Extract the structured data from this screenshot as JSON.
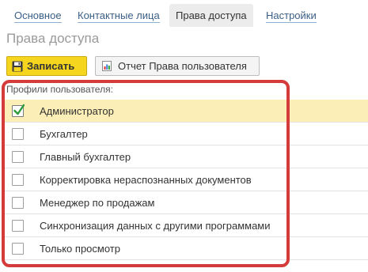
{
  "tabs": [
    {
      "label": "Основное",
      "active": false
    },
    {
      "label": "Контактные лица",
      "active": false
    },
    {
      "label": "Права доступа",
      "active": true
    },
    {
      "label": "Настройки",
      "active": false
    }
  ],
  "page_title": "Права доступа",
  "toolbar": {
    "save_label": "Записать",
    "report_label": "Отчет Права пользователя",
    "save_icon": "floppy-disk-icon",
    "report_icon": "report-icon"
  },
  "profiles": {
    "label": "Профили пользователя:",
    "items": [
      {
        "label": "Администратор",
        "checked": true,
        "selected": true
      },
      {
        "label": "Бухгалтер",
        "checked": false,
        "selected": false
      },
      {
        "label": "Главный бухгалтер",
        "checked": false,
        "selected": false
      },
      {
        "label": "Корректировка нераспознанных документов",
        "checked": false,
        "selected": false
      },
      {
        "label": "Менеджер по продажам",
        "checked": false,
        "selected": false
      },
      {
        "label": "Синхронизация данных с другими программами",
        "checked": false,
        "selected": false
      },
      {
        "label": "Только просмотр",
        "checked": false,
        "selected": false
      }
    ]
  },
  "colors": {
    "accent_yellow": "#f5d51e",
    "selected_row": "#fbeeb6",
    "highlight_red": "#d63b3b",
    "check_green": "#2e9b3a",
    "link_blue": "#3a5f86"
  }
}
